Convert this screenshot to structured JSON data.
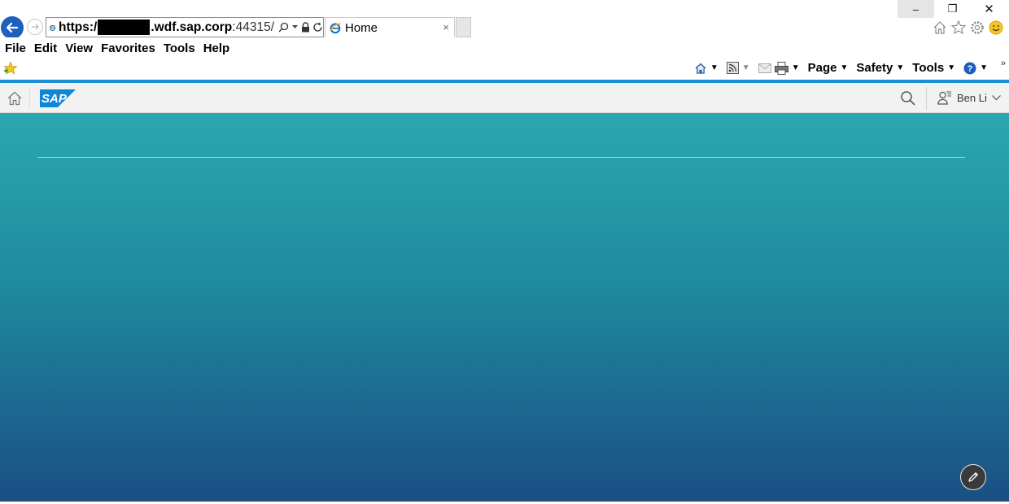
{
  "window": {
    "controls": {
      "minimize": "–",
      "maximize": "❐",
      "close": "✕"
    }
  },
  "address": {
    "scheme": "https:/",
    "host_bold": ".wdf.sap.corp",
    "host_rest": ":44315/"
  },
  "tab": {
    "title": "Home",
    "close": "×"
  },
  "menu": {
    "items": [
      "File",
      "Edit",
      "View",
      "Favorites",
      "Tools",
      "Help"
    ]
  },
  "commandbar": {
    "page": "Page",
    "safety": "Safety",
    "tools": "Tools",
    "overflow": "»"
  },
  "shell": {
    "logo": "SAP",
    "user_name": "Ben Li"
  },
  "colors": {
    "accent": "#1b8fd6",
    "back_button": "#1f5fbd",
    "gradient_top": "#2ba7b0",
    "gradient_bottom": "#1b4f83"
  },
  "icons": [
    "back-arrow-icon",
    "forward-arrow-icon",
    "ie-page-icon",
    "search-icon",
    "lock-icon",
    "refresh-icon",
    "home-icon",
    "favorites-star-icon",
    "settings-gear-icon",
    "smiley-feedback-icon",
    "add-favorites-icon",
    "home-dropdown-icon",
    "rss-feed-icon",
    "mail-icon",
    "print-icon",
    "help-icon",
    "shell-home-icon",
    "shell-search-icon",
    "user-icon",
    "pencil-edit-icon"
  ]
}
